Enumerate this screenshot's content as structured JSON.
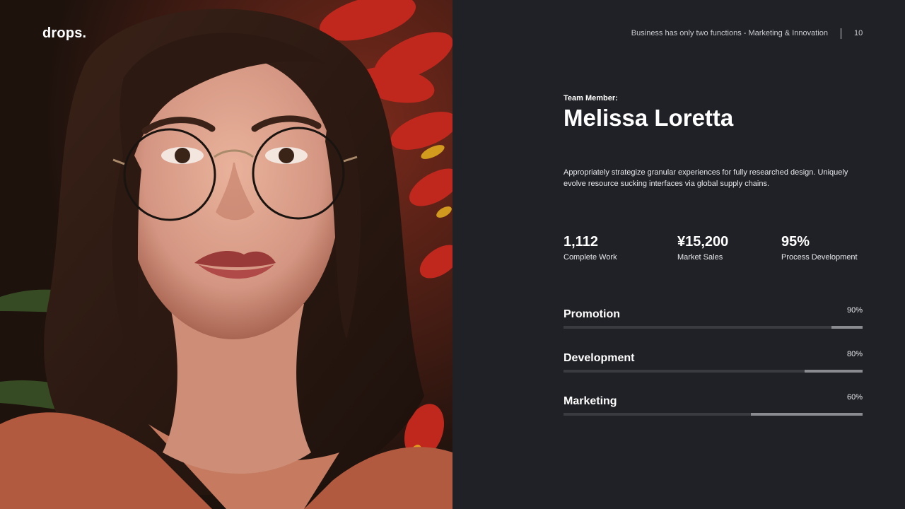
{
  "brand": {
    "logo_text": "drops."
  },
  "header": {
    "tagline": "Business has only two functions - Marketing & Innovation",
    "page_number": "10"
  },
  "profile": {
    "role_label": "Team Member:",
    "name": "Melissa Loretta",
    "bio": "Appropriately strategize granular experiences for fully researched design. Uniquely evolve resource sucking interfaces via global supply chains."
  },
  "stats": [
    {
      "value": "1,112",
      "label": "Complete  Work"
    },
    {
      "value": "¥15,200",
      "label": "Market Sales"
    },
    {
      "value": "95%",
      "label": "Process Development"
    }
  ],
  "skills": [
    {
      "label": "Promotion",
      "percent_text": "90%",
      "level": 0.9
    },
    {
      "label": "Development",
      "percent_text": "80%",
      "level": 0.8
    },
    {
      "label": "Marketing",
      "percent_text": "60%",
      "level": 0.6
    }
  ],
  "colors": {
    "background": "#202126",
    "text": "#ffffff",
    "track": "#3a3b41",
    "fill": "#8a8b90"
  },
  "photo": {
    "subject": "portrait-woman-glasses"
  }
}
